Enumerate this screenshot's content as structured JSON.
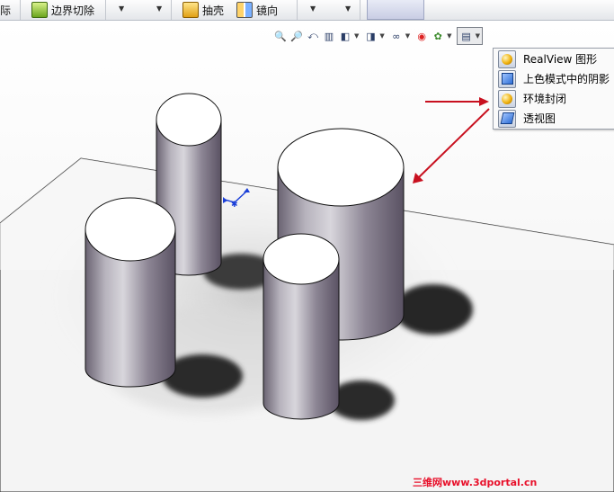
{
  "cmdbar": {
    "left_partial": "际",
    "boundary_cut_label": "边界切除",
    "shell_label": "抽壳",
    "mirror_label": "镜向",
    "dropdown_glyph": "▼"
  },
  "hud": {
    "icons": [
      "zoom-to-fit-icon",
      "zoom-to-area-icon",
      "previous-view-icon",
      "section-view-icon",
      "view-orientation-icon",
      "display-style-icon",
      "hide-show-items-icon",
      "edit-appearance-icon",
      "apply-scene-icon",
      "view-settings-icon"
    ]
  },
  "flyout": {
    "items": [
      {
        "label": "RealView 图形",
        "icon": "realview-icon"
      },
      {
        "label": "上色模式中的阴影",
        "icon": "shadows-icon"
      },
      {
        "label": "环境封闭",
        "icon": "ambient-occlusion-icon"
      },
      {
        "label": "透视图",
        "icon": "perspective-icon"
      }
    ]
  },
  "colors": {
    "arrow": "#c8101f",
    "cylinder_dark": "#5e5766",
    "cylinder_light": "#c9c6ce",
    "triad": "#1a3fd8"
  },
  "watermark": "三维网www.3dportal.cn"
}
